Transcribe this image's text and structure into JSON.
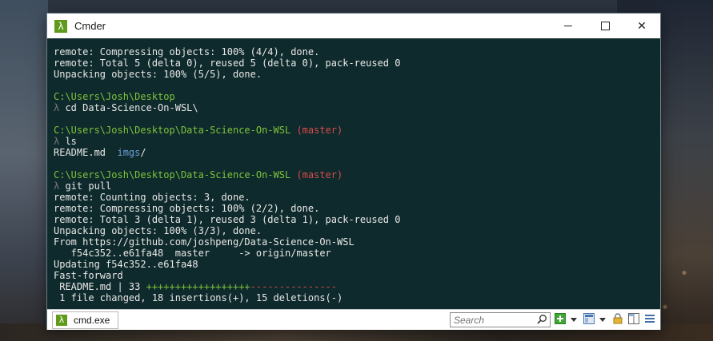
{
  "window": {
    "title": "Cmder"
  },
  "console_lines": [
    [
      {
        "t": "remote: Compressing objects: 100% (4/4), done.",
        "c": ""
      }
    ],
    [
      {
        "t": "remote: Total 5 (delta 0), reused 5 (delta 0), pack-reused 0",
        "c": ""
      }
    ],
    [
      {
        "t": "Unpacking objects: 100% (5/5), done.",
        "c": ""
      }
    ],
    [],
    [
      {
        "t": "C:\\Users\\Josh\\Desktop",
        "c": "c-path"
      }
    ],
    [
      {
        "t": "λ ",
        "c": "c-lambda"
      },
      {
        "t": "cd Data-Science-On-WSL\\",
        "c": ""
      }
    ],
    [],
    [
      {
        "t": "C:\\Users\\Josh\\Desktop\\Data-Science-On-WSL",
        "c": "c-path"
      },
      {
        "t": " (master)",
        "c": "c-branch"
      }
    ],
    [
      {
        "t": "λ ",
        "c": "c-lambda"
      },
      {
        "t": "ls",
        "c": ""
      }
    ],
    [
      {
        "t": "README.md  ",
        "c": ""
      },
      {
        "t": "imgs",
        "c": "c-dir"
      },
      {
        "t": "/",
        "c": ""
      }
    ],
    [],
    [
      {
        "t": "C:\\Users\\Josh\\Desktop\\Data-Science-On-WSL",
        "c": "c-path"
      },
      {
        "t": " (master)",
        "c": "c-branch"
      }
    ],
    [
      {
        "t": "λ ",
        "c": "c-lambda"
      },
      {
        "t": "git pull",
        "c": ""
      }
    ],
    [
      {
        "t": "remote: Counting objects: 3, done.",
        "c": ""
      }
    ],
    [
      {
        "t": "remote: Compressing objects: 100% (2/2), done.",
        "c": ""
      }
    ],
    [
      {
        "t": "remote: Total 3 (delta 1), reused 3 (delta 1), pack-reused 0",
        "c": ""
      }
    ],
    [
      {
        "t": "Unpacking objects: 100% (3/3), done.",
        "c": ""
      }
    ],
    [
      {
        "t": "From https://github.com/joshpeng/Data-Science-On-WSL",
        "c": ""
      }
    ],
    [
      {
        "t": "   f54c352..e61fa48  master     -> origin/master",
        "c": ""
      }
    ],
    [
      {
        "t": "Updating f54c352..e61fa48",
        "c": ""
      }
    ],
    [
      {
        "t": "Fast-forward",
        "c": ""
      }
    ],
    [
      {
        "t": " README.md | 33 ",
        "c": ""
      },
      {
        "t": "++++++++++++++++++",
        "c": "c-plus"
      },
      {
        "t": "---------------",
        "c": "c-minus"
      }
    ],
    [
      {
        "t": " 1 file changed, 18 insertions(+), 15 deletions(-)",
        "c": ""
      }
    ]
  ],
  "statusbar": {
    "tab_label": "cmd.exe",
    "search_placeholder": "Search"
  },
  "icons": {
    "app": "lambda-icon",
    "search": "search-icon",
    "new_tab": "plus-icon",
    "layout": "window-layout-icon",
    "lock": "lock-icon",
    "split": "split-view-icon",
    "menu": "hamburger-menu-icon"
  },
  "colors": {
    "console_bg": "#0f2a2c",
    "path": "#7cc33a",
    "branch": "#d84b4b",
    "dir": "#6a9fd8",
    "accent": "#5f9a1b"
  }
}
